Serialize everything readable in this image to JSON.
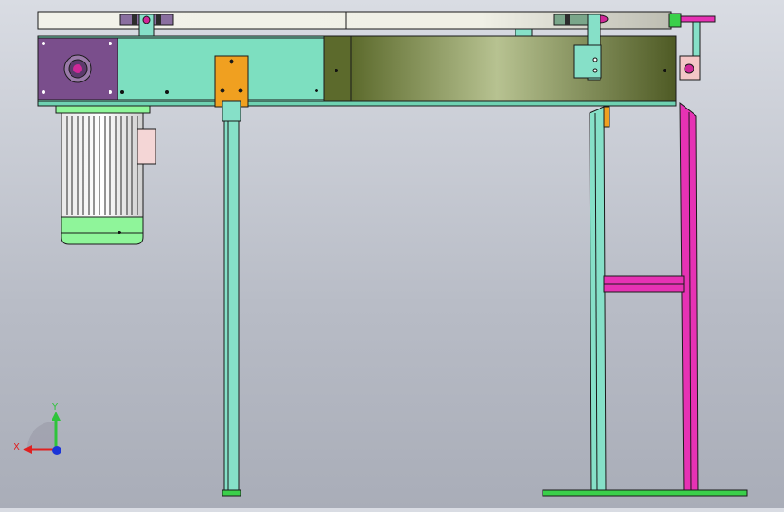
{
  "view": {
    "background_top": "#d9dce3",
    "background_bottom": "#a9adb8"
  },
  "colors": {
    "conveyor_frame": "#7ddfc0",
    "belt_cover": "#9fae6d",
    "motor_green": "#8ff59a",
    "motor_housing": "#ffffff",
    "motor_plate": "#7a4e8c",
    "orange_bracket": "#f0a020",
    "magenta_leg": "#e632b4",
    "teal_leg": "#86e0c8",
    "base_plate": "#3ad04a",
    "outline": "#1a1a1a"
  },
  "triad": {
    "x_label": "X",
    "y_label": "Y"
  }
}
